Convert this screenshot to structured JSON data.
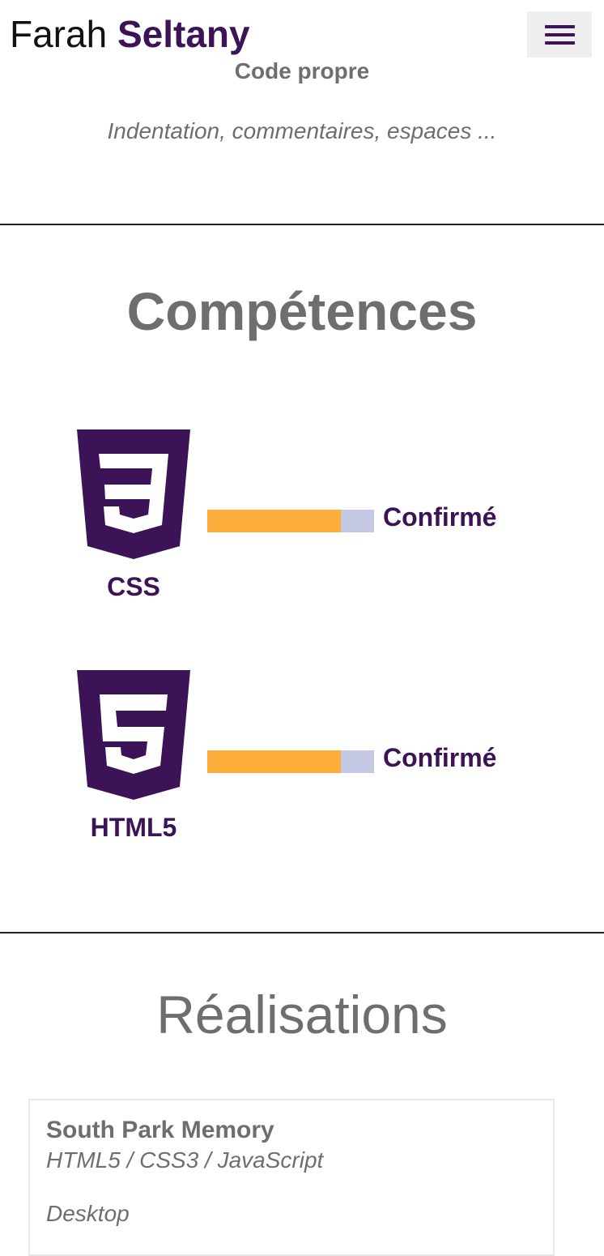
{
  "header": {
    "brand_first": "Farah",
    "brand_last": "Seltany",
    "menu_icon": "hamburger-menu-icon"
  },
  "previous_section": {
    "title": "Code propre",
    "description": "Indentation, commentaires, espaces ..."
  },
  "skills": {
    "title": "Compétences",
    "items": [
      {
        "name": "CSS",
        "icon": "css3-logo-icon",
        "level_label": "Confirmé",
        "level_percent": 80
      },
      {
        "name": "HTML5",
        "icon": "html5-logo-icon",
        "level_label": "Confirmé",
        "level_percent": 80
      }
    ]
  },
  "projects": {
    "title": "Réalisations",
    "items": [
      {
        "title": "South Park Memory",
        "tech": "HTML5 / CSS3 / JavaScript",
        "platform": "Desktop"
      }
    ]
  },
  "colors": {
    "accent_purple": "#3b1356",
    "bar_fill": "#fdae3b",
    "bar_track": "#c5c9e6",
    "text_gray": "#6e6e6e"
  }
}
